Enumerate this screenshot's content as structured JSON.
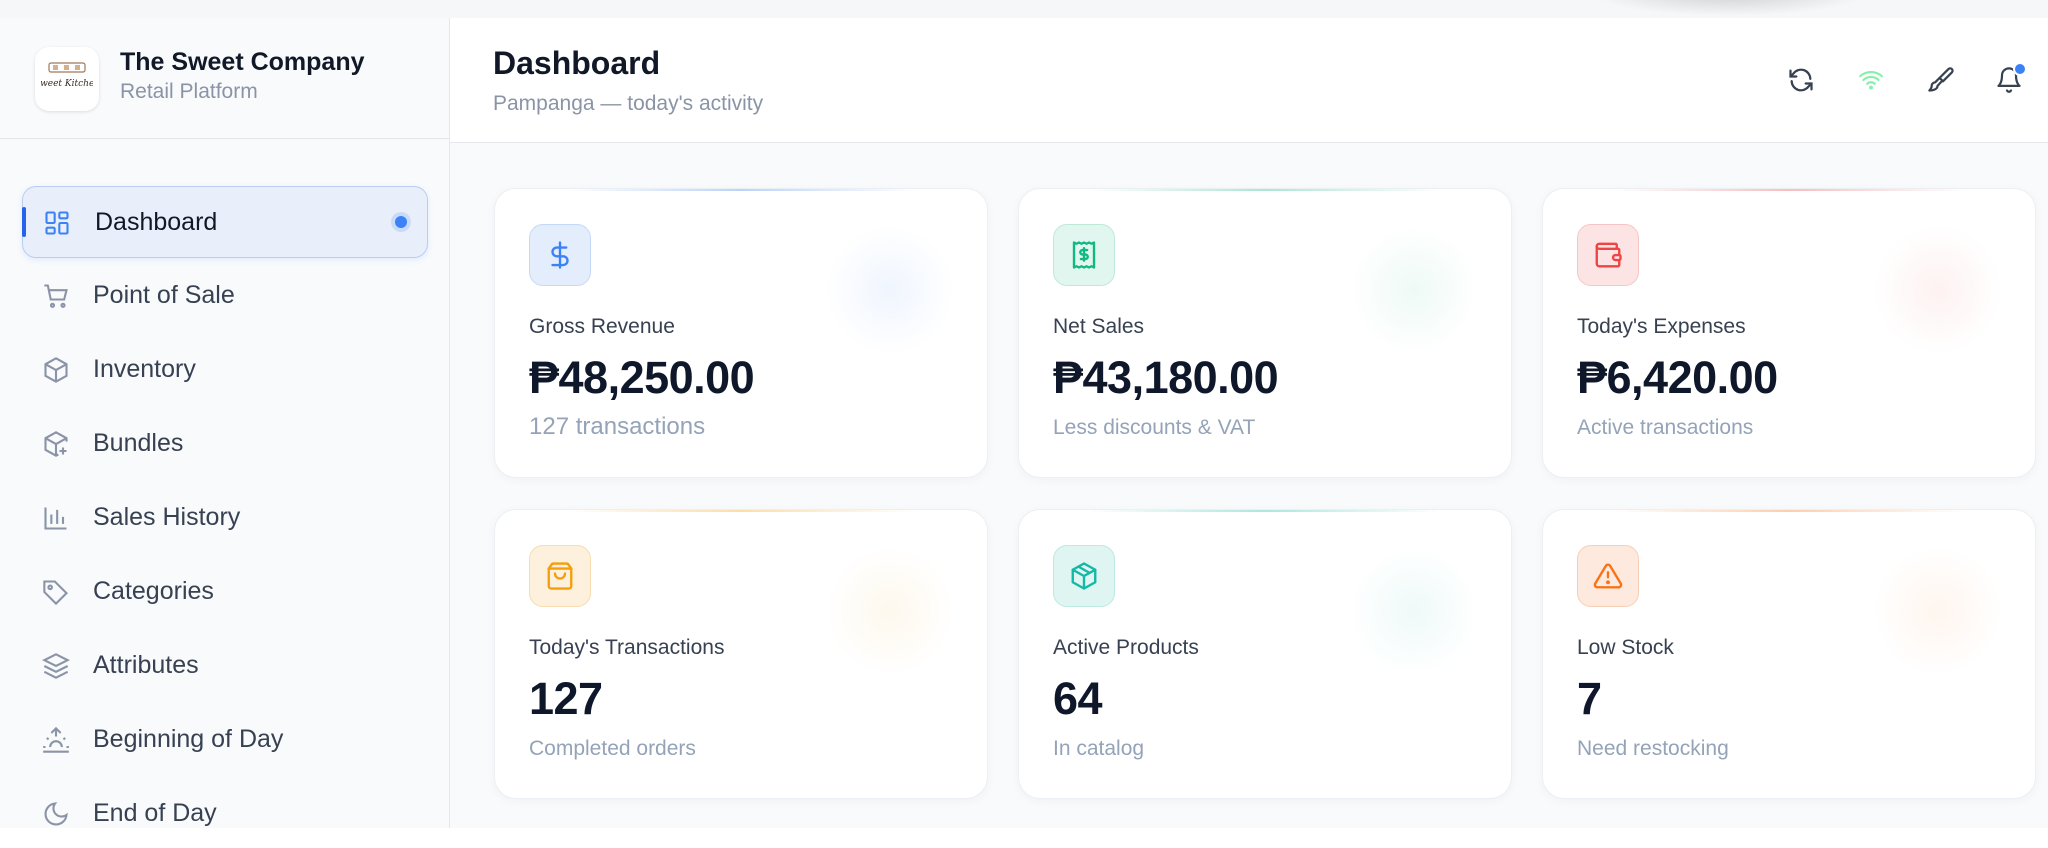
{
  "brand": {
    "name": "The Sweet Company",
    "subtitle": "Retail Platform",
    "logo_text": "Sweet Kitchen"
  },
  "sidebar": {
    "items": [
      {
        "label": "Dashboard",
        "icon": "dashboard-grid-icon",
        "active": true
      },
      {
        "label": "Point of Sale",
        "icon": "shopping-cart-icon"
      },
      {
        "label": "Inventory",
        "icon": "box-icon"
      },
      {
        "label": "Bundles",
        "icon": "box-plus-icon"
      },
      {
        "label": "Sales History",
        "icon": "bar-chart-icon"
      },
      {
        "label": "Categories",
        "icon": "tag-icon"
      },
      {
        "label": "Attributes",
        "icon": "layers-icon"
      },
      {
        "label": "Beginning of Day",
        "icon": "sunrise-icon"
      },
      {
        "label": "End of Day",
        "icon": "moon-icon"
      }
    ]
  },
  "header": {
    "title": "Dashboard",
    "subtitle": "Pampanga — today's activity",
    "actions": [
      {
        "icon": "refresh-icon"
      },
      {
        "icon": "wifi-icon",
        "color": "#86efac"
      },
      {
        "icon": "paintbrush-icon"
      },
      {
        "icon": "bell-icon",
        "has_notification": true
      }
    ]
  },
  "stats": [
    {
      "label": "Gross Revenue",
      "value": "₱48,250.00",
      "sub": "127 transactions",
      "icon": "dollar-sign-icon",
      "accent": "#3b82f6"
    },
    {
      "label": "Net Sales",
      "value": "₱43,180.00",
      "sub": "Less discounts & VAT",
      "icon": "receipt-icon",
      "accent": "#10b981"
    },
    {
      "label": "Today's Expenses",
      "value": "₱6,420.00",
      "sub": "Active transactions",
      "icon": "wallet-icon",
      "accent": "#ef4444"
    },
    {
      "label": "Today's Transactions",
      "value": "127",
      "sub": "Completed orders",
      "icon": "shopping-bag-icon",
      "accent": "#f59e0b"
    },
    {
      "label": "Active Products",
      "value": "64",
      "sub": "In catalog",
      "icon": "package-icon",
      "accent": "#14b8a6"
    },
    {
      "label": "Low Stock",
      "value": "7",
      "sub": "Need restocking",
      "icon": "alert-triangle-icon",
      "accent": "#f97316"
    }
  ]
}
